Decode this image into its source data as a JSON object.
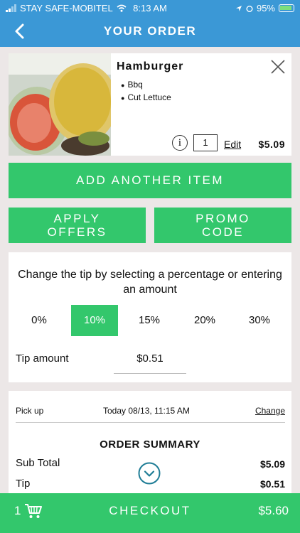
{
  "status_bar": {
    "carrier": "STAY SAFE-MOBITEL",
    "time": "8:13 AM",
    "battery": "95%"
  },
  "header": {
    "title": "YOUR ORDER"
  },
  "item": {
    "name": "Hamburger",
    "modifiers": [
      "Bbq",
      "Cut Lettuce"
    ],
    "info_glyph": "i",
    "quantity": "1",
    "edit_label": "Edit",
    "price": "$5.09"
  },
  "actions": {
    "add_label": "ADD ANOTHER ITEM",
    "offers_line1": "APPLY",
    "offers_line2": "OFFERS",
    "promo_line1": "PROMO",
    "promo_line2": "CODE"
  },
  "tip": {
    "instruction": "Change the tip by selecting a percentage or entering an amount",
    "options": [
      "0%",
      "10%",
      "15%",
      "20%",
      "30%"
    ],
    "selected": "10%",
    "amount_label": "Tip amount",
    "amount_value": "$0.51"
  },
  "summary": {
    "pickup_label": "Pick up",
    "pickup_time": "Today 08/13, 11:15 AM",
    "change_label": "Change",
    "title": "ORDER SUMMARY",
    "rows": [
      {
        "label": "Sub Total",
        "value": "$5.09"
      },
      {
        "label": "Tip",
        "value": "$0.51"
      }
    ]
  },
  "checkout": {
    "cart_count": "1",
    "label": "CHECKOUT",
    "total": "$5.60"
  },
  "colors": {
    "header_blue": "#3b98d6",
    "accent_green": "#33c76c",
    "background": "#ece7e7",
    "expand_teal": "#1f7d96"
  }
}
